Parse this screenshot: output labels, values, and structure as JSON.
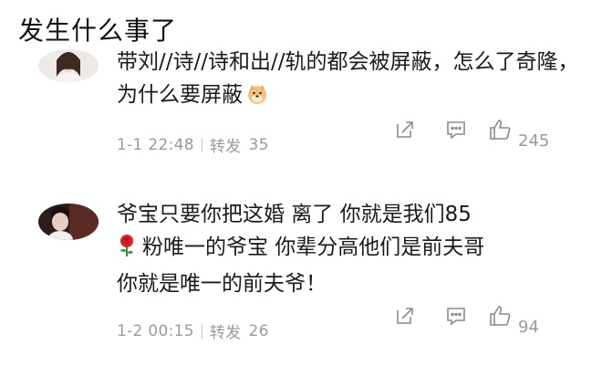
{
  "page": {
    "title": "发生什么事了"
  },
  "comments": [
    {
      "text": "带刘//诗//诗和出//轨的都会被屏蔽，怎么了奇隆，为什么要屏蔽",
      "inline_emoji": "doge-emoji",
      "date": "1-1 22:48",
      "repost_label": "转发",
      "repost_count": "35",
      "like_count": "245"
    },
    {
      "text_prefix": "爷宝只要你把这婚 离了 你就是我们85",
      "inline_emoji": "rose-emoji",
      "text_suffix": "粉唯一的爷宝 你辈分高他们是前夫哥\n你就是唯一的前夫爷！",
      "date": "1-2 00:15",
      "repost_label": "转发",
      "repost_count": "26",
      "like_count": "94"
    }
  ],
  "icons": {
    "share": "share-icon",
    "comment": "comment-icon",
    "like": "thumbs-up-icon"
  },
  "colors": {
    "text": "#1a1a1a",
    "meta": "#9a9a9a",
    "background": "#ffffff"
  }
}
